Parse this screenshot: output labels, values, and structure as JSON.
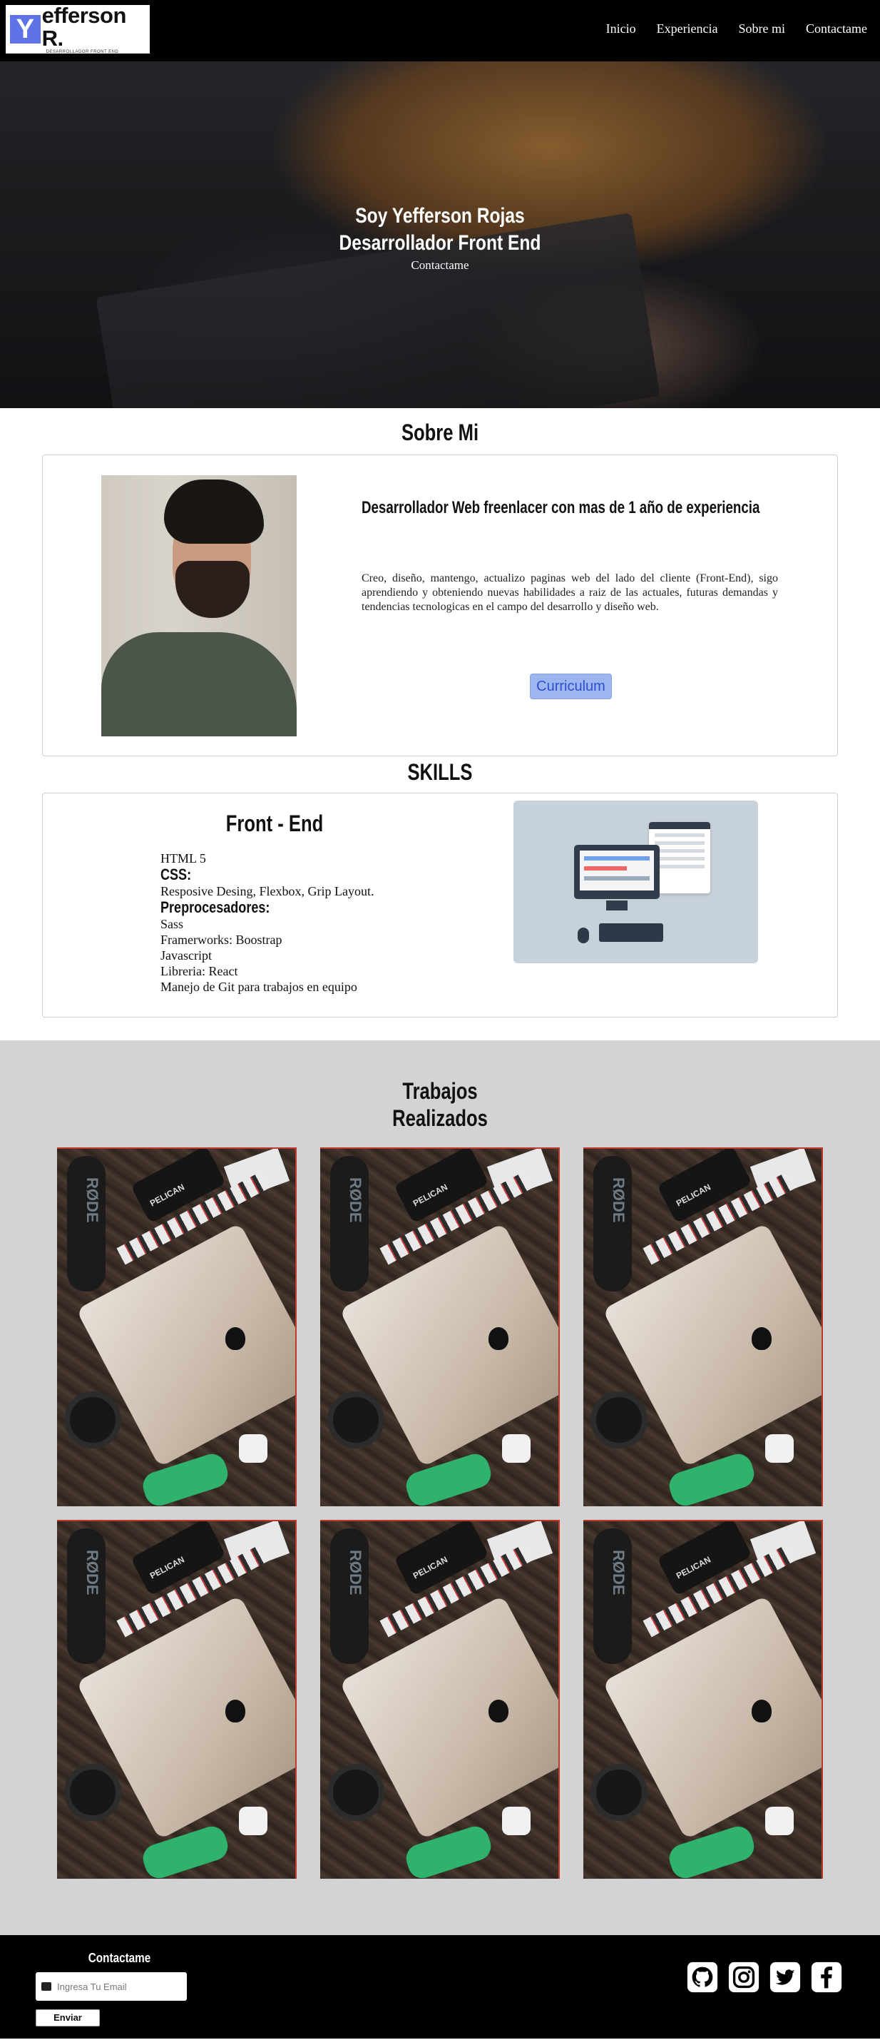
{
  "nav": {
    "logo_letter": "Y",
    "logo_name": "efferson R.",
    "logo_sub": "DESARROLLADOR FRONT END",
    "links": [
      "Inicio",
      "Experiencia",
      "Sobre mi",
      "Contactame"
    ]
  },
  "hero": {
    "line1": "Soy Yefferson Rojas",
    "line2": "Desarrollador Front End",
    "cta": "Contactame"
  },
  "about": {
    "title": "Sobre Mi",
    "subtitle": "Desarrollador Web freenlacer con mas de 1 año de experiencia",
    "description": "Creo, diseño, mantengo, actualizo paginas web del lado del cliente (Front-End), sigo aprendiendo y obteniendo nuevas habilidades a raiz de las actuales, futuras demandas y tendencias tecnologicas en el campo del desarrollo y diseño web.",
    "cv_button": "Curriculum"
  },
  "skills": {
    "title": "SKILLS",
    "card_title": "Front - End",
    "items": [
      {
        "text": "HTML 5",
        "head": false
      },
      {
        "text": "CSS:",
        "head": true
      },
      {
        "text": "Resposive Desing, Flexbox, Grip Layout.",
        "head": false
      },
      {
        "text": "Preprocesadores:",
        "head": true
      },
      {
        "text": "Sass",
        "head": false
      },
      {
        "text": "Framerworks: Boostrap",
        "head": false
      },
      {
        "text": "Javascript",
        "head": false
      },
      {
        "text": "Libreria: React",
        "head": false
      },
      {
        "text": "Manejo de Git para trabajos en equipo",
        "head": false
      }
    ]
  },
  "works": {
    "title_line1": "Trabajos",
    "title_line2": "Realizados",
    "brand_case": "PELICAN",
    "brand_mic": "RØDE",
    "count": 6
  },
  "footer": {
    "title": "Contactame",
    "email_placeholder": "Ingresa Tu Email",
    "send_label": "Enviar",
    "social": [
      "github-icon",
      "instagram-icon",
      "twitter-icon",
      "facebook-icon"
    ]
  },
  "colors": {
    "accent": "#5f73e8",
    "cv_button_bg": "#9fb5f0",
    "works_bg": "#d3d3d3",
    "nav_bg": "#000000"
  }
}
